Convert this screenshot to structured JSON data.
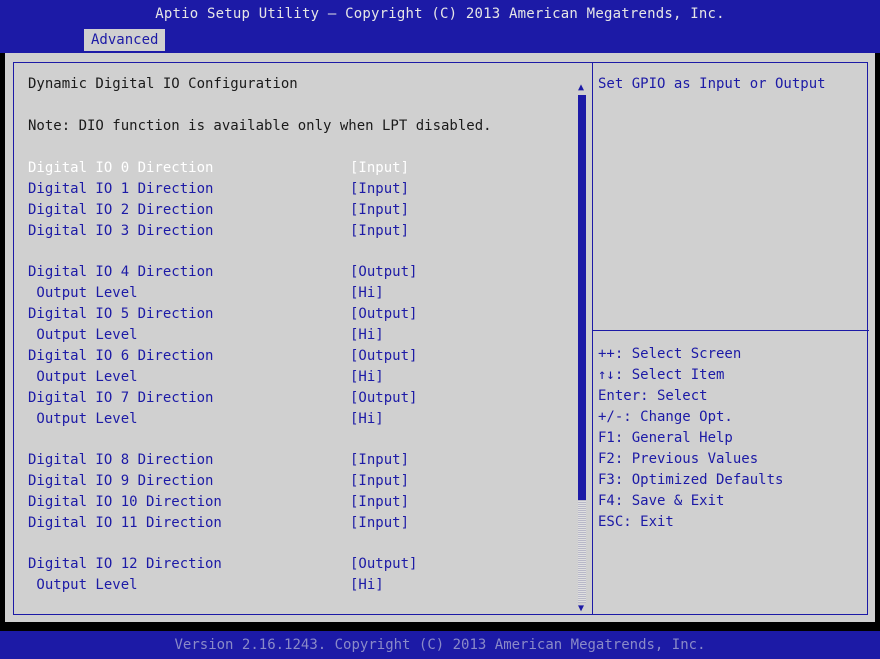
{
  "header": {
    "title": "Aptio Setup Utility – Copyright (C) 2013 American Megatrends, Inc.",
    "tab": "Advanced"
  },
  "main": {
    "heading": "Dynamic Digital IO Configuration",
    "note": "Note: DIO function is available only when LPT disabled.",
    "items": [
      {
        "label": "Digital IO 0 Direction",
        "value": "[Input]"
      },
      {
        "label": "Digital IO 1 Direction",
        "value": "[Input]"
      },
      {
        "label": "Digital IO 2 Direction",
        "value": "[Input]"
      },
      {
        "label": "Digital IO 3 Direction",
        "value": "[Input]"
      },
      {
        "label": "Digital IO 4 Direction",
        "value": "[Output]"
      },
      {
        "label": " Output Level",
        "value": "[Hi]"
      },
      {
        "label": "Digital IO 5 Direction",
        "value": "[Output]"
      },
      {
        "label": " Output Level",
        "value": "[Hi]"
      },
      {
        "label": "Digital IO 6 Direction",
        "value": "[Output]"
      },
      {
        "label": " Output Level",
        "value": "[Hi]"
      },
      {
        "label": "Digital IO 7 Direction",
        "value": "[Output]"
      },
      {
        "label": " Output Level",
        "value": "[Hi]"
      },
      {
        "label": "Digital IO 8 Direction",
        "value": "[Input]"
      },
      {
        "label": "Digital IO 9 Direction",
        "value": "[Input]"
      },
      {
        "label": "Digital IO 10 Direction",
        "value": "[Input]"
      },
      {
        "label": "Digital IO 11 Direction",
        "value": "[Input]"
      },
      {
        "label": "Digital IO 12 Direction",
        "value": "[Output]"
      },
      {
        "label": " Output Level",
        "value": "[Hi]"
      }
    ]
  },
  "help": {
    "description": "Set GPIO as Input or Output",
    "keys": [
      "++: Select Screen",
      "↑↓: Select Item",
      "Enter: Select",
      "+/-: Change Opt.",
      "F1: General Help",
      "F2: Previous Values",
      "F3: Optimized Defaults",
      "F4: Save & Exit",
      "ESC: Exit"
    ]
  },
  "scrollbar": {
    "up": "▲",
    "down": "▼"
  },
  "footer": {
    "text": "Version 2.16.1243. Copyright (C) 2013 American Megatrends, Inc."
  }
}
